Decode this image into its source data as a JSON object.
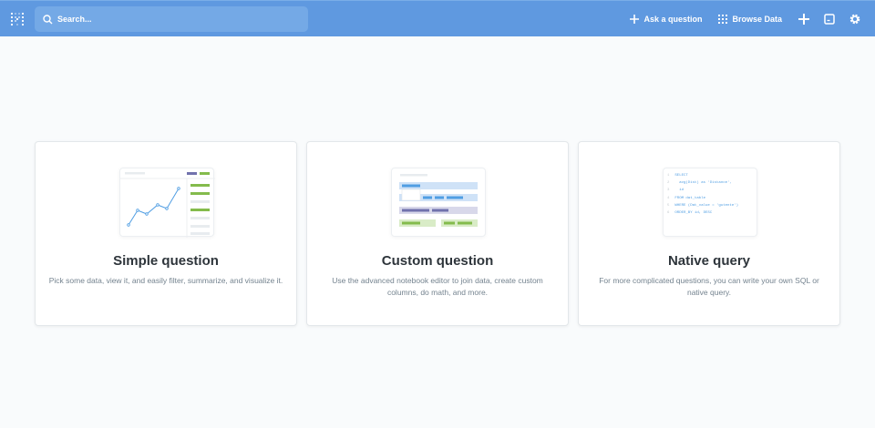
{
  "nav": {
    "search_placeholder": "Search...",
    "ask_question": "Ask a question",
    "browse_data": "Browse Data"
  },
  "cards": [
    {
      "title": "Simple question",
      "description": "Pick some data, view it, and easily filter, summarize, and visualize it."
    },
    {
      "title": "Custom question",
      "description": "Use the advanced notebook editor to join data, create custom columns, do math, and more."
    },
    {
      "title": "Native query",
      "description": "For more complicated questions, you can write your own SQL or native query."
    }
  ],
  "sql_lines": [
    "SELECT",
    "  avg(Dist) as 'Distance',",
    "  id",
    "FROM dat_table",
    "WHERE (Dat_value = 'gutente')",
    "ORDER_BY id, DESC"
  ],
  "colors": {
    "nav": "#5f99e0",
    "green": "#84bb4c",
    "purple": "#7172ad",
    "blue": "#509ee3"
  }
}
